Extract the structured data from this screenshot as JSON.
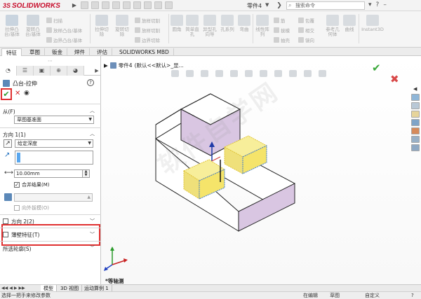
{
  "app": {
    "name": "SOLIDWORKS",
    "doc_title": "零件4"
  },
  "search": {
    "placeholder": "搜索命令"
  },
  "ribbon": {
    "large_buttons": [
      {
        "label": "拉伸凸\n台/基体",
        "icon": "extrude-boss-icon"
      },
      {
        "label": "旋转凸\n台/基体",
        "icon": "revolve-boss-icon"
      },
      {
        "label": "拉伸切\n除",
        "icon": "extrude-cut-icon"
      },
      {
        "label": "旋转切\n除",
        "icon": "revolve-cut-icon"
      },
      {
        "label": "圆角",
        "icon": "fillet-icon"
      },
      {
        "label": "简单直\n孔",
        "icon": "simple-hole-icon"
      },
      {
        "label": "异型孔\n向导",
        "icon": "hole-wizard-icon"
      },
      {
        "label": "孔系列",
        "icon": "hole-series-icon"
      },
      {
        "label": "弯曲",
        "icon": "flex-icon"
      },
      {
        "label": "线性阵\n列",
        "icon": "linear-pattern-icon"
      },
      {
        "label": "参考几\n何体",
        "icon": "reference-geometry-icon"
      },
      {
        "label": "曲线",
        "icon": "curves-icon"
      },
      {
        "label": "Instant3D",
        "icon": "instant3d-icon"
      }
    ],
    "small_buttons": {
      "sweep": "扫描",
      "loft": "放样凸台/基体",
      "boundary": "边界凸台/基体",
      "sweep_cut": "放样切割",
      "loft_cut": "放样切割",
      "boundary_cut": "边界切除",
      "rib": "筋",
      "draft": "拔模",
      "shell": "抽壳",
      "wrap": "包覆",
      "intersect": "相交",
      "mirror": "镜向"
    }
  },
  "tabs": [
    "特征",
    "草图",
    "钣金",
    "焊件",
    "评估",
    "SOLIDWORKS MBD"
  ],
  "property_manager": {
    "title": "凸台-拉伸",
    "from_label": "从(F)",
    "from_value": "草图基准面",
    "direction1_label": "方向 1(1)",
    "end_condition": "给定深度",
    "depth_value": "10.00mm",
    "merge_result": "合并结果(M)",
    "draft_outward": "向外拔模(O)",
    "direction2_label": "方向 2(2)",
    "thin_feature_label": "薄壁特征(T)",
    "selected_contours_label": "所选轮廓(S)"
  },
  "viewport": {
    "breadcrumb_part": "零件4",
    "breadcrumb_config": "(默认<<默认>_显...",
    "view_name": "*等轴测"
  },
  "bottom_tabs": [
    "模型",
    "3D 视图",
    "运动算例 1"
  ],
  "status": {
    "hint": "选择一把手来修改参数",
    "editing": "在编辑",
    "mode": "草图",
    "custom": "自定义",
    "help": "?"
  },
  "watermark": "软件自学网",
  "colors": {
    "sw_red": "#c8102e",
    "highlight_red": "#e03030",
    "preview_yellow": "#f5e46a",
    "face_lavender": "#d9c6e2",
    "ok_green": "#2e9e2e"
  }
}
